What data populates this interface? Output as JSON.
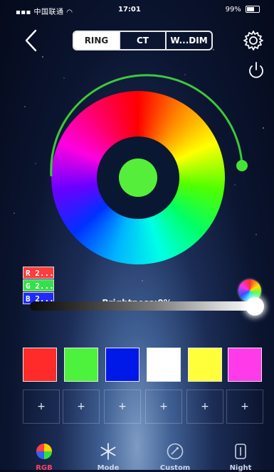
{
  "status_bar": {
    "carrier": "中国联通",
    "time": "17:01",
    "battery": "99%"
  },
  "tabs": [
    {
      "label": "RING",
      "active": true
    },
    {
      "label": "CT",
      "active": false
    },
    {
      "label": "W...DIM",
      "active": false
    }
  ],
  "color": {
    "selected_hex": "#55ee3b",
    "r_label": "R 2...",
    "g_label": "G 2...",
    "b_label": "B 2..."
  },
  "brightness": {
    "label": "Brightness:0%",
    "value_percent": 0
  },
  "presets": [
    {
      "color": "#ff2a2a"
    },
    {
      "color": "#4cf23b"
    },
    {
      "color": "#0018e8"
    },
    {
      "color": "#ffffff"
    },
    {
      "color": "#ffff3a"
    },
    {
      "color": "#ff3ae8"
    }
  ],
  "add_slots": [
    "+",
    "+",
    "+",
    "+",
    "+",
    "+"
  ],
  "bottom_nav": [
    {
      "label": "RGB",
      "icon": "color-wheel-icon",
      "active": true
    },
    {
      "label": "Mode",
      "icon": "snowflake-icon",
      "active": false
    },
    {
      "label": "Custom",
      "icon": "custom-icon",
      "active": false
    },
    {
      "label": "Night",
      "icon": "night-icon",
      "active": false
    }
  ]
}
